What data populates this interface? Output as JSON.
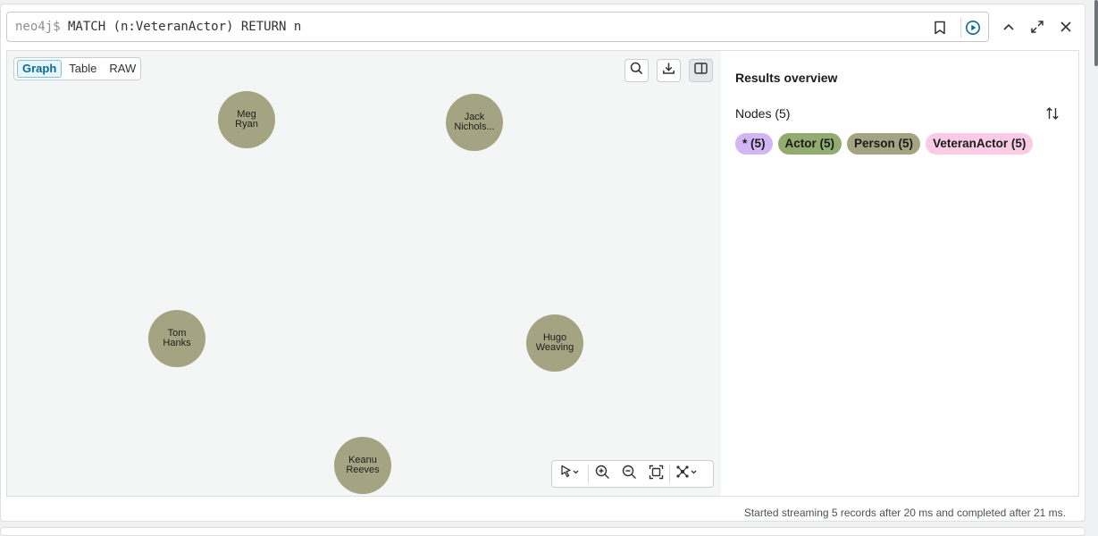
{
  "editor": {
    "prompt": "neo4j$",
    "query": "MATCH (n:VeteranActor) RETURN n"
  },
  "view_tabs": [
    {
      "label": "Graph",
      "active": true
    },
    {
      "label": "Table",
      "active": false
    },
    {
      "label": "RAW",
      "active": false
    }
  ],
  "nodes": [
    {
      "line1": "Meg",
      "line2": "Ryan"
    },
    {
      "line1": "Jack",
      "line2": "Nichols..."
    },
    {
      "line1": "Tom",
      "line2": "Hanks"
    },
    {
      "line1": "Hugo",
      "line2": "Weaving"
    },
    {
      "line1": "Keanu",
      "line2": "Reeves"
    }
  ],
  "sidebar": {
    "title": "Results overview",
    "nodes_label": "Nodes (5)",
    "chips": [
      {
        "label": "* (5)",
        "color": "#d2b6f3"
      },
      {
        "label": "Actor (5)",
        "color": "#92ac6f"
      },
      {
        "label": "Person (5)",
        "color": "#a5a482"
      },
      {
        "label": "VeteranActor (5)",
        "color": "#f9cbe5"
      }
    ]
  },
  "status": "Started streaming 5 records after 20 ms and completed after 21 ms.",
  "colors": {
    "node_fill": "#a5a482",
    "accent": "#0a6b8f"
  },
  "icons": {
    "editor": [
      "bookmark-icon",
      "run-icon"
    ],
    "frame": [
      "collapse-icon",
      "fullscreen-icon",
      "close-icon"
    ],
    "canvas": [
      "search-icon",
      "download-icon",
      "panel-toggle-icon"
    ],
    "tools": [
      "pointer-icon",
      "zoom-in-icon",
      "zoom-out-icon",
      "fit-icon",
      "layout-icon"
    ]
  }
}
